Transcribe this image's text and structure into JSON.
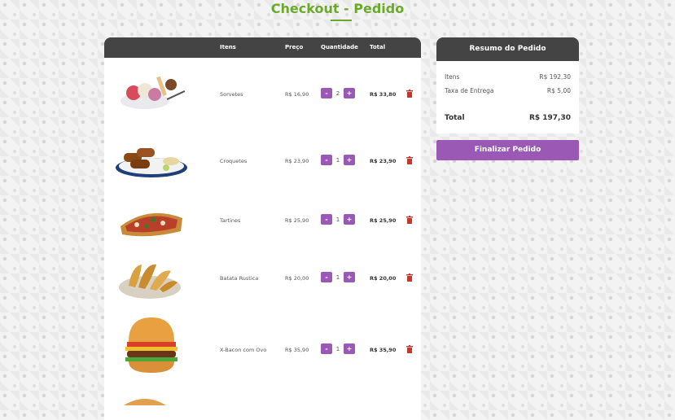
{
  "page": {
    "title": "Checkout - Pedido"
  },
  "cart": {
    "headers": {
      "items": "Itens",
      "price": "Preço",
      "qty": "Quantidade",
      "total": "Total"
    },
    "rows": [
      {
        "name": "Sorvetes",
        "price": "R$ 16,90",
        "qty": "2",
        "total": "R$ 33,80"
      },
      {
        "name": "Croquetes",
        "price": "R$ 23,90",
        "qty": "1",
        "total": "R$ 23,90"
      },
      {
        "name": "Tartines",
        "price": "R$ 25,90",
        "qty": "1",
        "total": "R$ 25,90"
      },
      {
        "name": "Batata Rustica",
        "price": "R$ 20,00",
        "qty": "1",
        "total": "R$ 20,00"
      },
      {
        "name": "X-Bacon com Ovo",
        "price": "R$ 35,90",
        "qty": "1",
        "total": "R$ 35,90"
      }
    ],
    "minus": "-",
    "plus": "+"
  },
  "summary": {
    "title": "Resumo do Pedido",
    "items_label": "Itens",
    "items_value": "R$ 192,30",
    "delivery_label": "Taxa de Entrega",
    "delivery_value": "R$ 5,00",
    "total_label": "Total",
    "total_value": "R$ 197,30"
  },
  "actions": {
    "finish": "Finalizar Pedido"
  },
  "colors": {
    "brand": "#6aaa2a",
    "accent": "#9b59b6",
    "header": "#444444",
    "danger": "#c0392b"
  }
}
